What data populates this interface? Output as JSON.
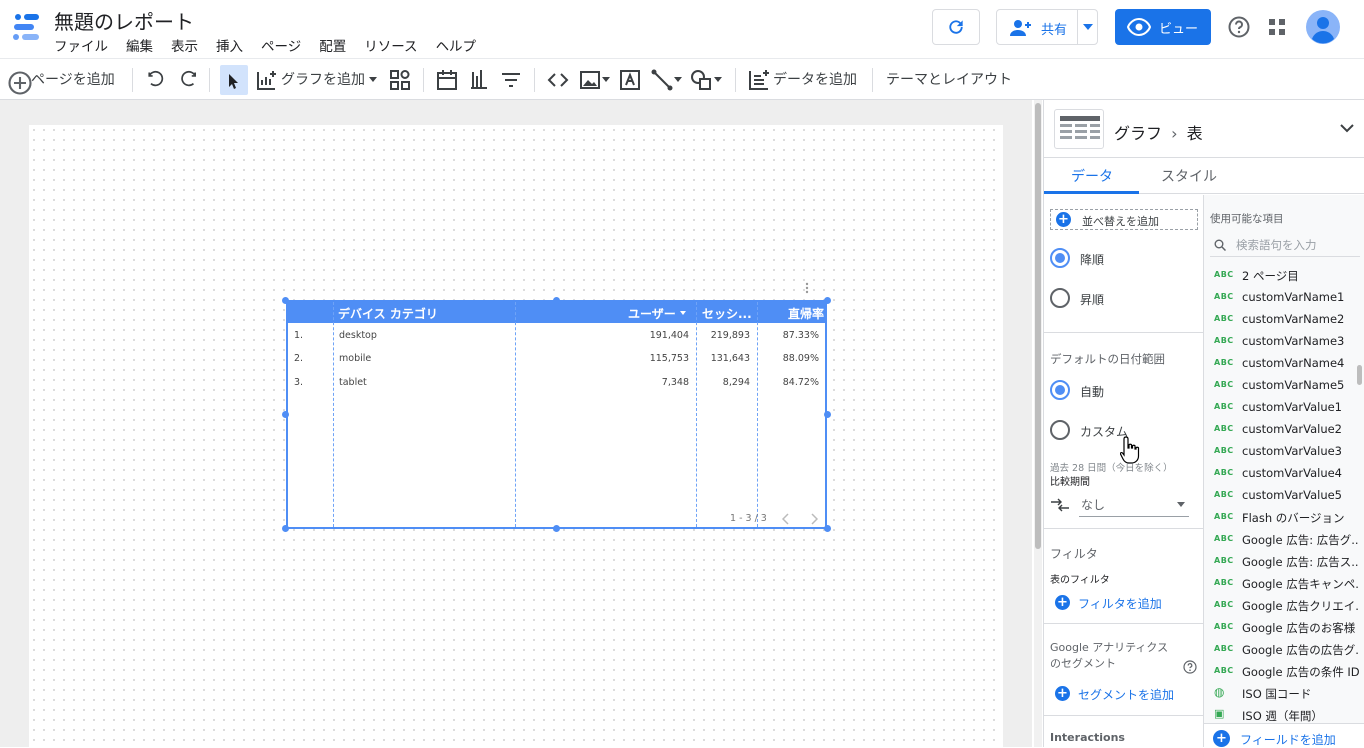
{
  "header": {
    "title": "無題のレポート",
    "menu": [
      "ファイル",
      "編集",
      "表示",
      "挿入",
      "ページ",
      "配置",
      "リソース",
      "ヘルプ"
    ],
    "share_label": "共有",
    "view_label": "ビュー"
  },
  "toolbar": {
    "add_page": "ページを追加",
    "add_chart": "グラフを追加",
    "add_data": "データを追加",
    "theme_layout": "テーマとレイアウト"
  },
  "table": {
    "columns": [
      "デバイス カテゴリ",
      "ユーザー",
      "セッシ...",
      "直帰率"
    ],
    "rows": [
      {
        "idx": "1.",
        "category": "desktop",
        "users": "191,404",
        "sessions": "219,893",
        "bounce": "87.33%"
      },
      {
        "idx": "2.",
        "category": "mobile",
        "users": "115,753",
        "sessions": "131,643",
        "bounce": "88.09%"
      },
      {
        "idx": "3.",
        "category": "tablet",
        "users": "7,348",
        "sessions": "8,294",
        "bounce": "84.72%"
      }
    ],
    "pagination": "1 - 3 / 3"
  },
  "panel": {
    "breadcrumb_root": "グラフ",
    "breadcrumb_leaf": "表",
    "tab_data": "データ",
    "tab_style": "スタイル",
    "add_sort": "並べ替えを追加",
    "desc": "降順",
    "asc": "昇順",
    "date_range_title": "デフォルトの日付範囲",
    "auto": "自動",
    "custom": "カスタム",
    "last28": "過去 28 日間（今日を除く）",
    "compare_label": "比較期間",
    "compare_value": "なし",
    "filter_title": "フィルタ",
    "table_filter": "表のフィルタ",
    "add_filter": "フィルタを追加",
    "segment_title": "Google アナリティクスのセグメント",
    "add_segment": "セグメントを追加",
    "interactions": "Interactions",
    "available_fields": "使用可能な項目",
    "search_placeholder": "検索語句を入力",
    "add_field": "フィールドを追加",
    "fields": [
      "2 ページ目",
      "customVarName1",
      "customVarName2",
      "customVarName3",
      "customVarName4",
      "customVarName5",
      "customVarValue1",
      "customVarValue2",
      "customVarValue3",
      "customVarValue4",
      "customVarValue5",
      "Flash のバージョン",
      "Google 広告: 広告グ...",
      "Google 広告: 広告ス...",
      "Google 広告キャンペ...",
      "Google 広告クリエイ...",
      "Google 広告のお客様 ...",
      "Google 広告の広告グ...",
      "Google 広告の条件 ID",
      "ISO 国コード",
      "ISO 週（年間）"
    ]
  }
}
